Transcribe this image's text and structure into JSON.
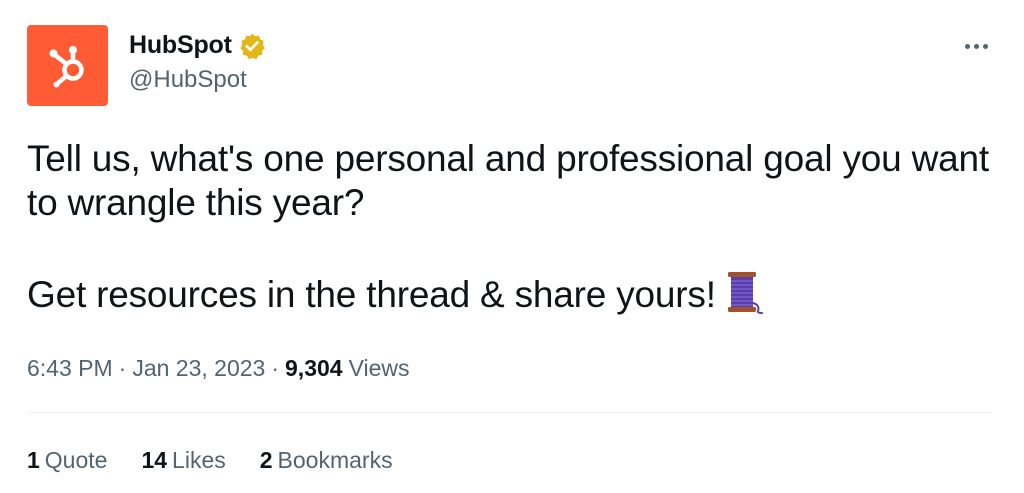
{
  "author": {
    "display_name": "HubSpot",
    "handle": "@HubSpot",
    "avatar_icon": "hubspot-sprocket-icon",
    "avatar_color": "#ff5c35",
    "verified_icon": "verified-badge-icon",
    "verified_color": "#e2b719"
  },
  "menu": {
    "icon": "more-horizontal-icon"
  },
  "tweet": {
    "line1": "Tell us, what's one personal and professional goal you want to wrangle this year?",
    "line2": "Get resources in the thread & share yours!",
    "emoji_icon": "spool-of-thread-icon"
  },
  "meta": {
    "time": "6:43 PM",
    "separator": "·",
    "date": "Jan 23, 2023",
    "views_count": "9,304",
    "views_label": "Views"
  },
  "stats": [
    {
      "count": "1",
      "label": "Quote"
    },
    {
      "count": "14",
      "label": "Likes"
    },
    {
      "count": "2",
      "label": "Bookmarks"
    }
  ],
  "colors": {
    "text_primary": "#0f1419",
    "text_secondary": "#536471",
    "divider": "#eff3f4"
  }
}
